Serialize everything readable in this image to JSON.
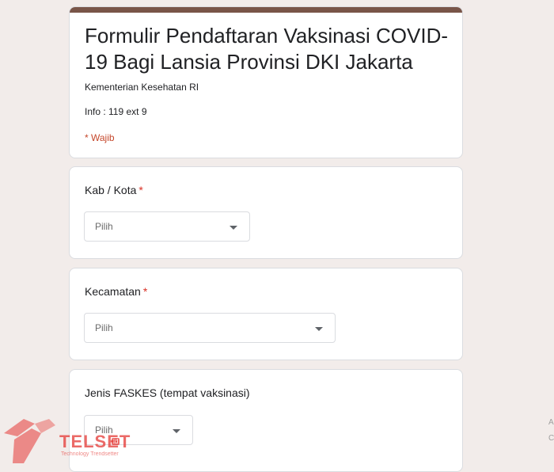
{
  "form": {
    "title": "Formulir Pendaftaran Vaksinasi COVID-19 Bagi Lansia Provinsi DKI Jakarta",
    "description_line1": "Kementerian Kesehatan RI",
    "description_line2": "Info : 119 ext 9",
    "required_note": "* Wajib",
    "accent_color": "#795548"
  },
  "questions": [
    {
      "label": "Kab / Kota",
      "required_marker": "*",
      "select_placeholder": "Pilih"
    },
    {
      "label": "Kecamatan",
      "required_marker": "*",
      "select_placeholder": "Pilih"
    },
    {
      "label": "Jenis FASKES (tempat vaksinasi)",
      "select_placeholder": "Pilih"
    }
  ],
  "watermark": {
    "brand": "TELSET",
    "badge": "id",
    "tagline": "Technology Trendsetter"
  },
  "edge_glyphs": [
    "A",
    "C"
  ]
}
